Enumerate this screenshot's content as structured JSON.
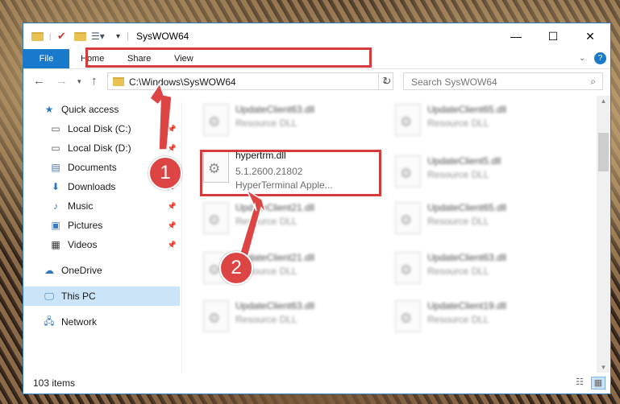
{
  "window": {
    "title": "SysWOW64",
    "controls": {
      "minimize": "—",
      "maximize": "☐",
      "close": "✕"
    }
  },
  "ribbon": {
    "tabs": [
      {
        "label": "File"
      },
      {
        "label": "Home"
      },
      {
        "label": "Share"
      },
      {
        "label": "View"
      }
    ],
    "collapse_icon": "chevron-down-icon",
    "help_icon": "?"
  },
  "address_bar": {
    "path": "C:\\Windows\\SysWOW64",
    "search_placeholder": "Search SysWOW64"
  },
  "sidebar": {
    "items": [
      {
        "label": "Quick access",
        "icon": "star-icon",
        "pinned": false
      },
      {
        "label": "Local Disk (C:)",
        "icon": "drive-icon",
        "pinned": true
      },
      {
        "label": "Local Disk (D:)",
        "icon": "drive-icon",
        "pinned": true
      },
      {
        "label": "Documents",
        "icon": "documents-icon",
        "pinned": true
      },
      {
        "label": "Downloads",
        "icon": "downloads-icon",
        "pinned": true
      },
      {
        "label": "Music",
        "icon": "music-icon",
        "pinned": true
      },
      {
        "label": "Pictures",
        "icon": "pictures-icon",
        "pinned": true
      },
      {
        "label": "Videos",
        "icon": "videos-icon",
        "pinned": true
      },
      {
        "label": "OneDrive",
        "icon": "cloud-icon",
        "pinned": false
      },
      {
        "label": "This PC",
        "icon": "computer-icon",
        "pinned": false,
        "selected": true
      },
      {
        "label": "Network",
        "icon": "network-icon",
        "pinned": false
      }
    ]
  },
  "files": [
    {
      "name": "UpdateClient63.dll",
      "sub": "Resource DLL",
      "blurred": true
    },
    {
      "name": "UpdateClient65.dll",
      "sub": "Resource DLL",
      "blurred": true
    },
    {
      "name": "hypertrm.dll",
      "version": "5.1.2600.21802",
      "description": "HyperTerminal Apple...",
      "blurred": false,
      "highlighted": true
    },
    {
      "name": "UpdateClient5.dll",
      "sub": "Resource DLL",
      "blurred": true
    },
    {
      "name": "UpdateClient21.dll",
      "sub": "Resource DLL",
      "blurred": true
    },
    {
      "name": "UpdateClient65.dll",
      "sub": "Resource DLL",
      "blurred": true
    },
    {
      "name": "UpdateClient21.dll",
      "sub": "Resource DLL",
      "blurred": true
    },
    {
      "name": "UpdateClient63.dll",
      "sub": "Resource DLL",
      "blurred": true
    },
    {
      "name": "UpdateClient63.dll",
      "sub": "Resource DLL",
      "blurred": true
    },
    {
      "name": "UpdateClient19.dll",
      "sub": "Resource DLL",
      "blurred": true
    }
  ],
  "status_bar": {
    "item_count": "103 items"
  },
  "callouts": [
    {
      "number": "1"
    },
    {
      "number": "2"
    }
  ],
  "colors": {
    "accent": "#1979ca",
    "highlight": "#d63a3a",
    "selected": "#cce4f7"
  }
}
